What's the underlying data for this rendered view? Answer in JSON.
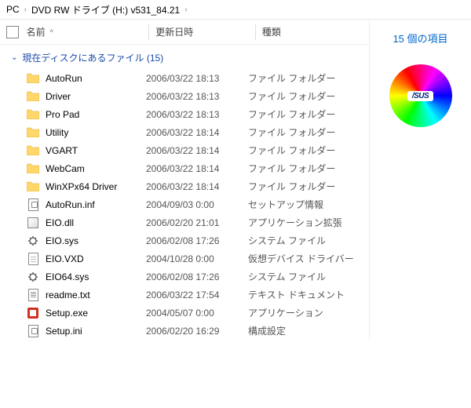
{
  "breadcrumb": {
    "seg1": "PC",
    "seg2": "DVD RW ドライブ (H:) v531_84.21"
  },
  "columns": {
    "name": "名前",
    "date": "更新日時",
    "type": "種類"
  },
  "sort_indicator": "^",
  "group_header": "現在ディスクにあるファイル (15)",
  "sidepane": {
    "count_text": "15 個の項目",
    "logo_text": "/SUS"
  },
  "items": [
    {
      "icon": "folder",
      "name": "AutoRun",
      "date": "2006/03/22 18:13",
      "type": "ファイル フォルダー"
    },
    {
      "icon": "folder",
      "name": "Driver",
      "date": "2006/03/22 18:13",
      "type": "ファイル フォルダー"
    },
    {
      "icon": "folder",
      "name": "Pro Pad",
      "date": "2006/03/22 18:13",
      "type": "ファイル フォルダー"
    },
    {
      "icon": "folder",
      "name": "Utility",
      "date": "2006/03/22 18:14",
      "type": "ファイル フォルダー"
    },
    {
      "icon": "folder",
      "name": "VGART",
      "date": "2006/03/22 18:14",
      "type": "ファイル フォルダー"
    },
    {
      "icon": "folder",
      "name": "WebCam",
      "date": "2006/03/22 18:14",
      "type": "ファイル フォルダー"
    },
    {
      "icon": "folder",
      "name": "WinXPx64 Driver",
      "date": "2006/03/22 18:14",
      "type": "ファイル フォルダー"
    },
    {
      "icon": "inf",
      "name": "AutoRun.inf",
      "date": "2004/09/03 0:00",
      "type": "セットアップ情報"
    },
    {
      "icon": "dll",
      "name": "EIO.dll",
      "date": "2006/02/20 21:01",
      "type": "アプリケーション拡張"
    },
    {
      "icon": "sys",
      "name": "EIO.sys",
      "date": "2006/02/08 17:26",
      "type": "システム ファイル"
    },
    {
      "icon": "file",
      "name": "EIO.VXD",
      "date": "2004/10/28 0:00",
      "type": "仮想デバイス ドライバー"
    },
    {
      "icon": "sys",
      "name": "EIO64.sys",
      "date": "2006/02/08 17:26",
      "type": "システム ファイル"
    },
    {
      "icon": "txt",
      "name": "readme.txt",
      "date": "2006/03/22 17:54",
      "type": "テキスト ドキュメント"
    },
    {
      "icon": "exe",
      "name": "Setup.exe",
      "date": "2004/05/07 0:00",
      "type": "アプリケーション"
    },
    {
      "icon": "ini",
      "name": "Setup.ini",
      "date": "2006/02/20 16:29",
      "type": "構成設定"
    }
  ]
}
